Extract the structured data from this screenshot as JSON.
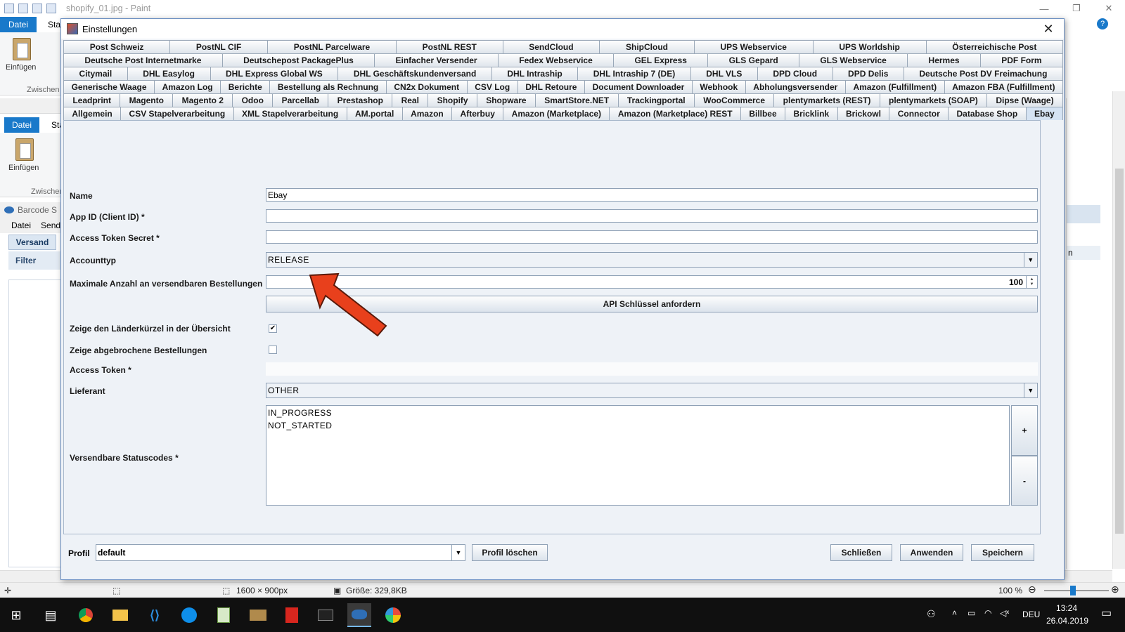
{
  "paint": {
    "window_title": "shopify_01.jpg - Paint",
    "datei_tab": "Datei",
    "start_tab": "Sta",
    "einfuegen": "Einfügen",
    "zwischen": "Zwischen",
    "sub_window_title": "Barcode S",
    "sub_menu": [
      "Datei",
      "Send"
    ],
    "versand_tab": "Versand",
    "filter_label": "Filter",
    "right_partial": "n",
    "status": {
      "image_size": "1600 × 900px",
      "file_size": "Größe: 329,8KB",
      "zoom": "100 %"
    }
  },
  "dialog": {
    "title": "Einstellungen",
    "tabs_rows": [
      [
        "Post Schweiz",
        "PostNL CIF",
        "PostNL Parcelware",
        "PostNL REST",
        "SendCloud",
        "ShipCloud",
        "UPS Webservice",
        "UPS Worldship",
        "Österreichische Post"
      ],
      [
        "Deutsche Post Internetmarke",
        "Deutschepost PackagePlus",
        "Einfacher Versender",
        "Fedex Webservice",
        "GEL Express",
        "GLS Gepard",
        "GLS Webservice",
        "Hermes",
        "PDF Form"
      ],
      [
        "Citymail",
        "DHL Easylog",
        "DHL Express Global WS",
        "DHL Geschäftskundenversand",
        "DHL Intraship",
        "DHL Intraship 7 (DE)",
        "DHL VLS",
        "DPD Cloud",
        "DPD Delis",
        "Deutsche Post DV Freimachung"
      ],
      [
        "Generische Waage",
        "Amazon Log",
        "Berichte",
        "Bestellung als Rechnung",
        "CN2x Dokument",
        "CSV Log",
        "DHL Retoure",
        "Document Downloader",
        "Webhook",
        "Abholungsversender",
        "Amazon (Fulfillment)",
        "Amazon FBA (Fulfillment)"
      ],
      [
        "Leadprint",
        "Magento",
        "Magento 2",
        "Odoo",
        "Parcellab",
        "Prestashop",
        "Real",
        "Shopify",
        "Shopware",
        "SmartStore.NET",
        "Trackingportal",
        "WooCommerce",
        "plentymarkets (REST)",
        "plentymarkets (SOAP)",
        "Dipse (Waage)"
      ],
      [
        "Allgemein",
        "CSV Stapelverarbeitung",
        "XML Stapelverarbeitung",
        "AM.portal",
        "Amazon",
        "Afterbuy",
        "Amazon (Marketplace)",
        "Amazon (Marketplace) REST",
        "Billbee",
        "Bricklink",
        "Brickowl",
        "Connector",
        "Database Shop",
        "Ebay"
      ]
    ],
    "active_tab": "Ebay",
    "form": {
      "name_label": "Name",
      "name_value": "Ebay",
      "app_id_label": "App ID (Client ID) *",
      "app_id_value": "",
      "secret_label": "Access Token Secret *",
      "secret_value": "",
      "accounttyp_label": "Accounttyp",
      "accounttyp_value": "RELEASE",
      "max_label": "Maximale Anzahl an versendbaren Bestellungen",
      "max_value": "100",
      "api_button": "API Schlüssel anfordern",
      "laender_label": "Zeige den Länderkürzel in der Übersicht",
      "laender_checked": true,
      "abgebrochen_label": "Zeige abgebrochene Bestellungen",
      "abgebrochen_checked": false,
      "access_token_label": "Access Token *",
      "access_token_value": "",
      "lieferant_label": "Lieferant",
      "lieferant_value": "OTHER",
      "status_label": "Versendbare Statuscodes *",
      "status_codes": [
        "IN_PROGRESS",
        "NOT_STARTED"
      ],
      "add_button": "+",
      "remove_button": "-"
    },
    "footer": {
      "profil_label": "Profil",
      "profil_value": "default",
      "profil_delete": "Profil löschen",
      "close": "Schließen",
      "apply": "Anwenden",
      "save": "Speichern"
    }
  },
  "taskbar": {
    "language": "DEU",
    "time": "13:24",
    "date": "26.04.2019"
  },
  "colors": {
    "accent": "#1979ca",
    "arrow": "#e8401c"
  }
}
